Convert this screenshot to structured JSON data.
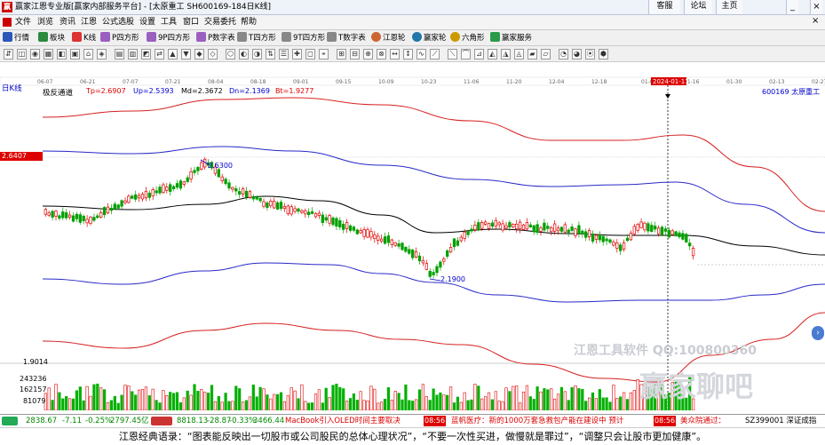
{
  "titlebar": {
    "app_title": "赢家江恩专业版[赢家内部服务平台] - [太原重工  SH600169-184日K线]",
    "buttons": [
      "客服",
      "论坛",
      "主页"
    ]
  },
  "menu": [
    "文件",
    "浏览",
    "资讯",
    "江恩",
    "公式选股",
    "设置",
    "工具",
    "窗口",
    "交易委托",
    "帮助"
  ],
  "toolbar1": [
    "行情",
    "板块",
    "K线",
    "P四方形",
    "9P四方形",
    "P数字表",
    "T四方形",
    "9T四方形",
    "T数字表",
    "江恩轮",
    "赢家轮",
    "六角形",
    "赢家服务"
  ],
  "chart": {
    "period_label": "日K线",
    "indicator_label": "极反通道",
    "tp": "Tp=2.6907",
    "up": "Up=2.5393",
    "md": "Md=2.3672",
    "dn": "Dn=2.1369",
    "bt": "Bt=1.9277",
    "stock": "600169  太原重工",
    "price_box": "2.6407",
    "high_label": "2.6300",
    "low_label": "2.1900",
    "axis_low": "1.9014",
    "vol_labels": [
      "243236",
      "162157",
      "81079"
    ],
    "date_highlight": "2024-01-11",
    "dates": [
      "06-07",
      "06-21",
      "07-07",
      "07-21",
      "08-04",
      "08-18",
      "09-01",
      "09-15",
      "10-09",
      "10-23",
      "11-06",
      "11-20",
      "12-04",
      "12-18",
      "01-02",
      "01-16",
      "01-30",
      "02-13",
      "02-27"
    ],
    "watermark1": "江恩工具软件  QQ:100800360",
    "watermark2": "赢家聊吧",
    "colors": {
      "up": "#e00000",
      "down": "#00a000",
      "outer": "#d62020",
      "inner": "#2828c8",
      "mid": "#000000"
    }
  },
  "status": {
    "sh": "2838.67",
    "sh_chg": "-7.11",
    "sh_pct": "-0.25%",
    "sh_amt": "2797.45亿",
    "sz": "8818.13",
    "sz_chg": "-28.87",
    "sz_pct": "-0.33%",
    "sz_amt": "3466.44",
    "news1": "MacBook引入OLED时间主要取决",
    "badge1": "08:56",
    "news2": "蓝帆医疗：新的1000万套急救包产能在建设中 预计",
    "badge2": "08:56",
    "news3": "美众院通过：",
    "code": "SZ399001 深证成指"
  },
  "footer": "江恩经典语录：“图表能反映出一切股市或公司股民的总体心理状况”，“不要一次性买进，做慢就是罪过”，“调整只会让股市更加健康”。"
}
